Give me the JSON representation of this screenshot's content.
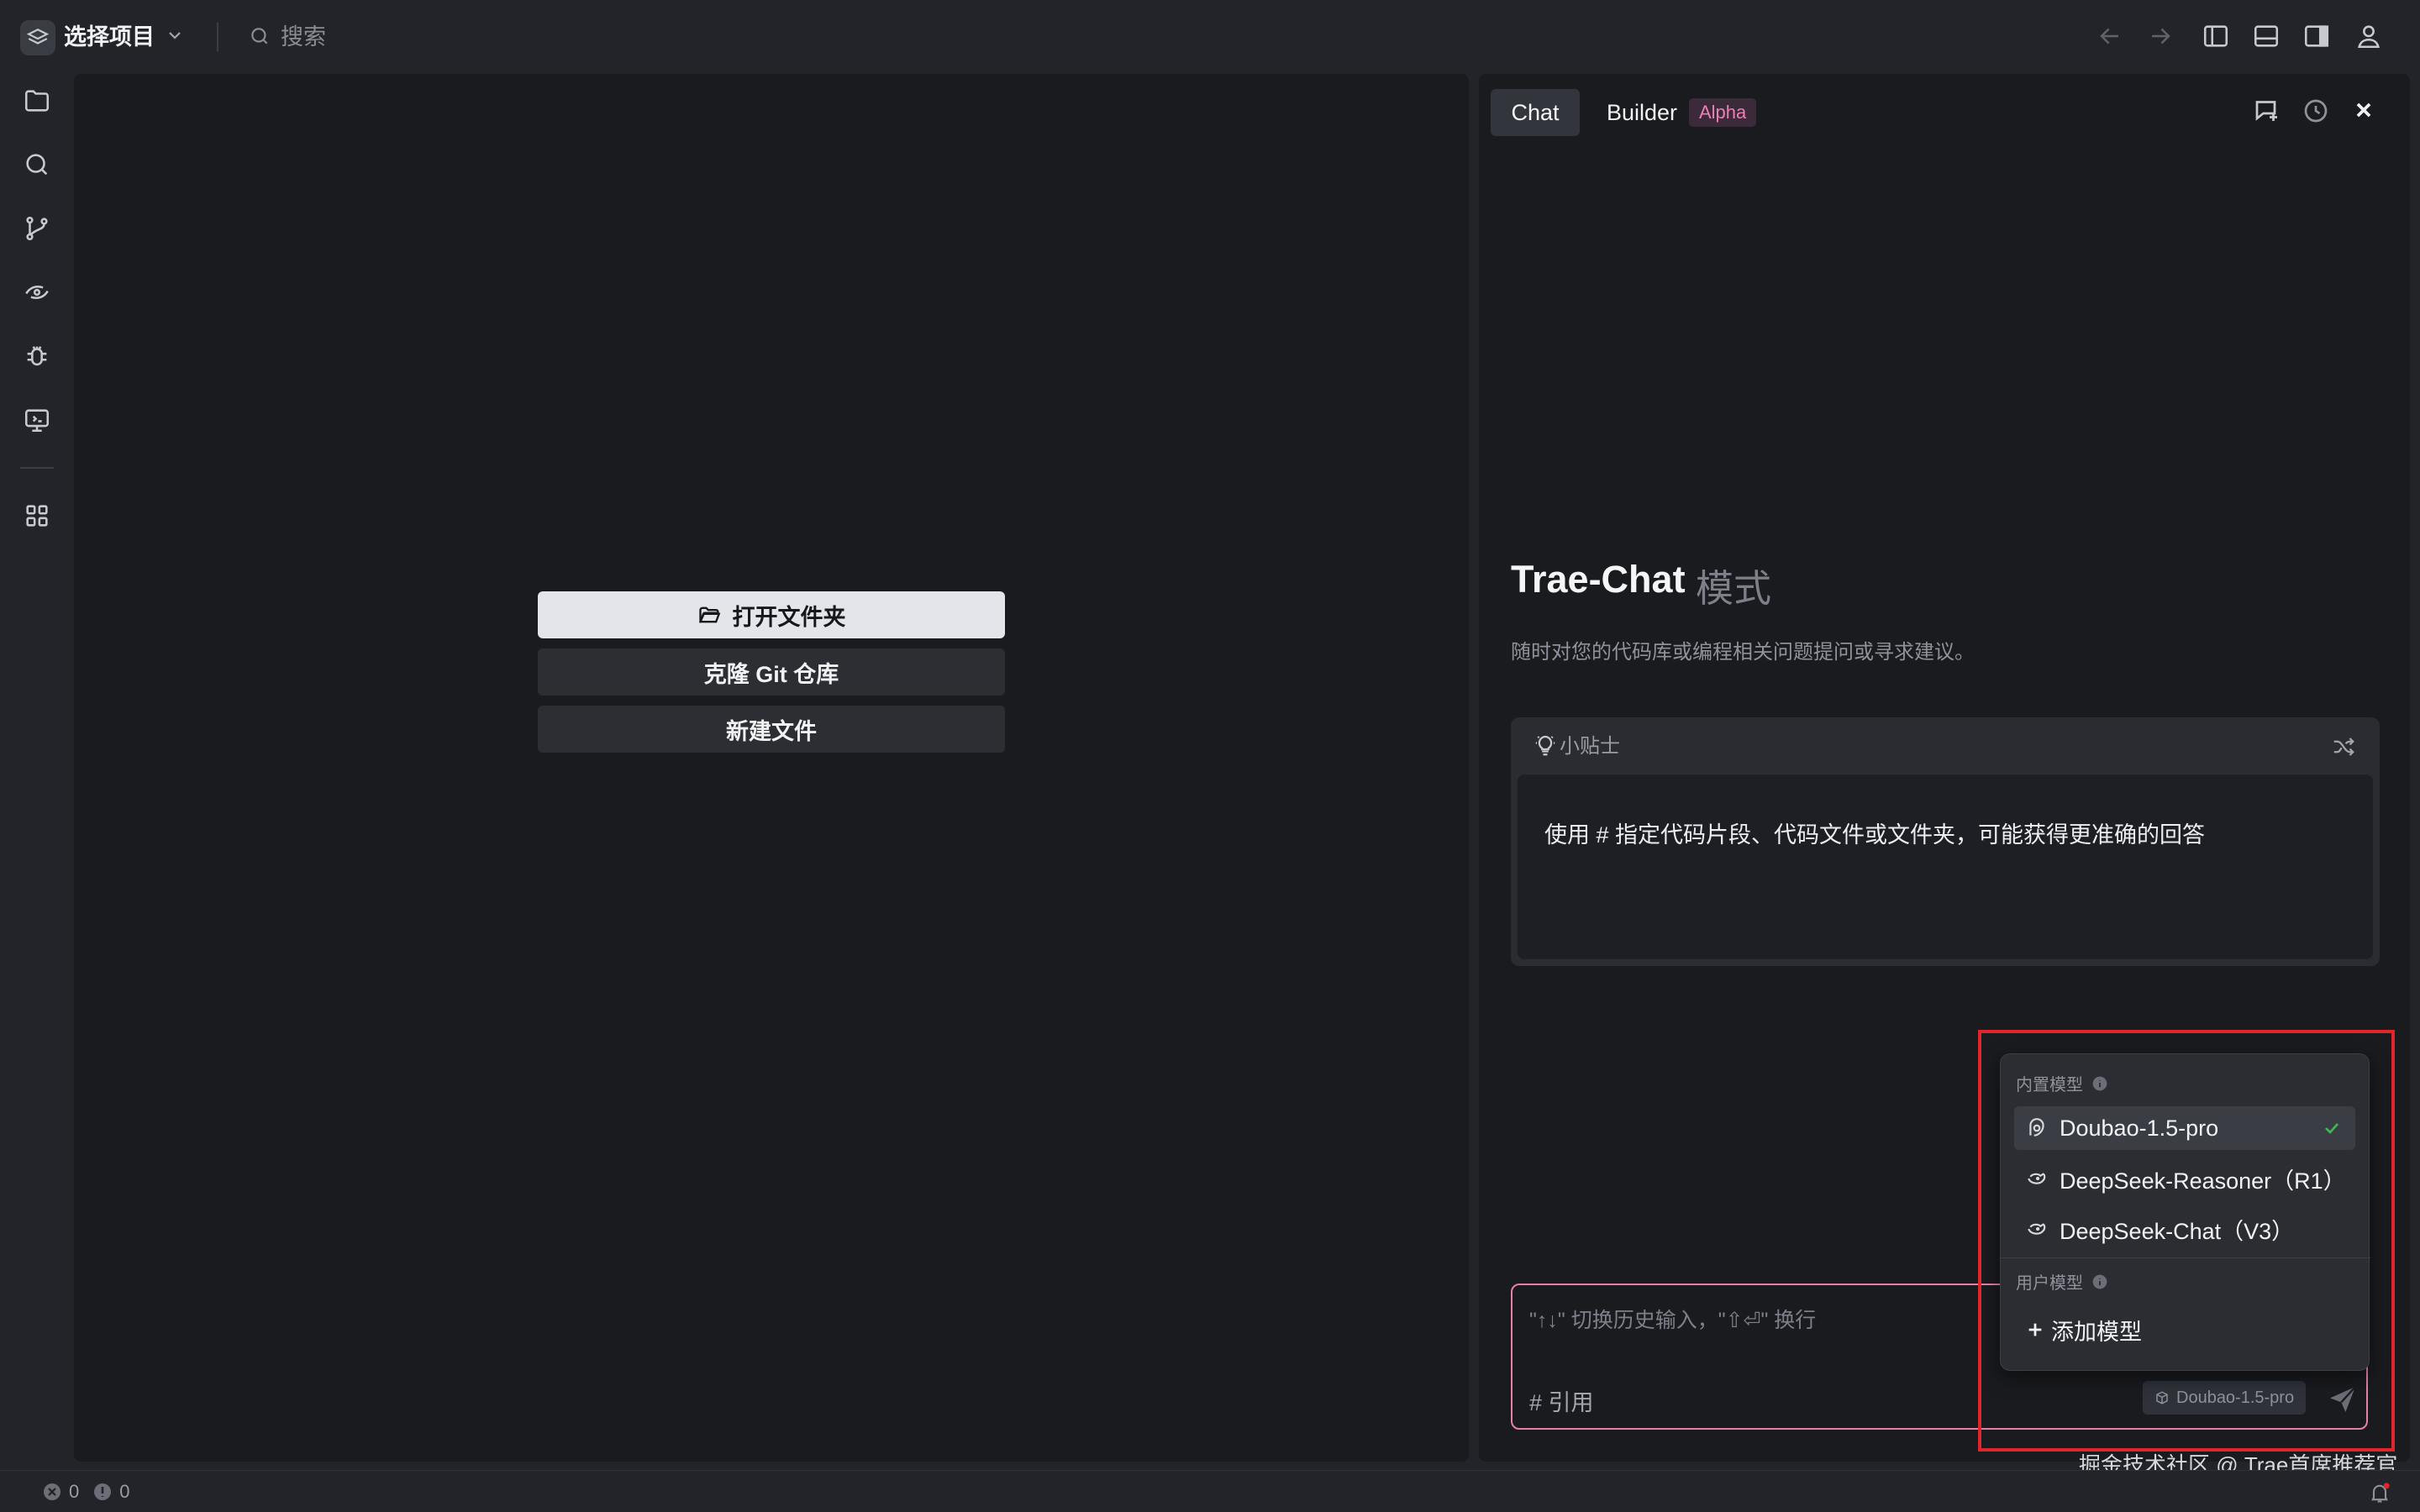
{
  "titlebar": {
    "project_label": "选择项目",
    "search_placeholder": "搜索"
  },
  "editor": {
    "buttons": {
      "open_folder": "打开文件夹",
      "clone_repo": "克隆 Git 仓库",
      "new_file": "新建文件"
    }
  },
  "panel": {
    "tabs": {
      "chat": "Chat",
      "builder": "Builder",
      "builder_badge": "Alpha"
    },
    "mode_title": "Trae-Chat",
    "mode_suffix": "模式",
    "mode_description": "随时对您的代码库或编程相关问题提问或寻求建议。",
    "tips": {
      "label": "小贴士",
      "text": "使用 # 指定代码片段、代码文件或文件夹，可能获得更准确的回答"
    },
    "input": {
      "placeholder": "\"↑↓\" 切换历史输入，\"⇧⏎\" 换行",
      "reference_label": "# 引用",
      "model_pill": "Doubao-1.5-pro"
    }
  },
  "model_dropdown": {
    "builtin_section": "内置模型",
    "user_section": "用户模型",
    "builtin_models": [
      {
        "label": "Doubao-1.5-pro",
        "selected": true
      },
      {
        "label": "DeepSeek-Reasoner（R1）",
        "selected": false
      },
      {
        "label": "DeepSeek-Chat（V3）",
        "selected": false
      }
    ],
    "add_model": "添加模型"
  },
  "watermark": "掘金技术社区 @ Trae首席推荐官",
  "statusbar": {
    "errors": "0",
    "warnings": "0"
  },
  "colors": {
    "accent_pink": "#e67fab",
    "highlight_red": "#e0262b",
    "check_green": "#3fb950"
  }
}
